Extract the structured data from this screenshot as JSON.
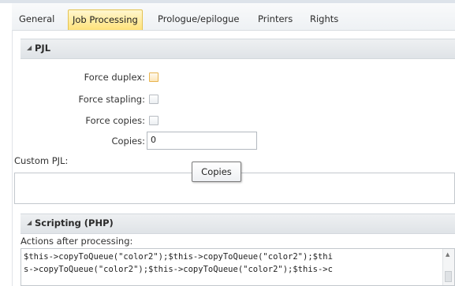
{
  "tabs": [
    {
      "label": "General"
    },
    {
      "label": "Job Processing"
    },
    {
      "label": "Prologue/epilogue"
    },
    {
      "label": "Printers"
    },
    {
      "label": "Rights"
    }
  ],
  "active_tab": "Job Processing",
  "pjl_section": {
    "title": "PJL",
    "force_duplex_label": "Force duplex:",
    "force_stapling_label": "Force stapling:",
    "force_copies_label": "Force copies:",
    "copies_label": "Copies:",
    "copies_value": "0",
    "custom_pjl_label": "Custom PJL:",
    "tooltip": "Copies"
  },
  "scripting_section": {
    "title": "Scripting (PHP)",
    "actions_label": "Actions after processing:",
    "code_lines": [
      "$this->copyToQueue(\"color2\");$this->copyToQueue(\"color2\");$thi",
      "s->copyToQueue(\"color2\");$this->copyToQueue(\"color2\");$this->c"
    ]
  },
  "colors": {
    "active_tab": "#ffe27a",
    "section_header": "#e3e6ea"
  }
}
